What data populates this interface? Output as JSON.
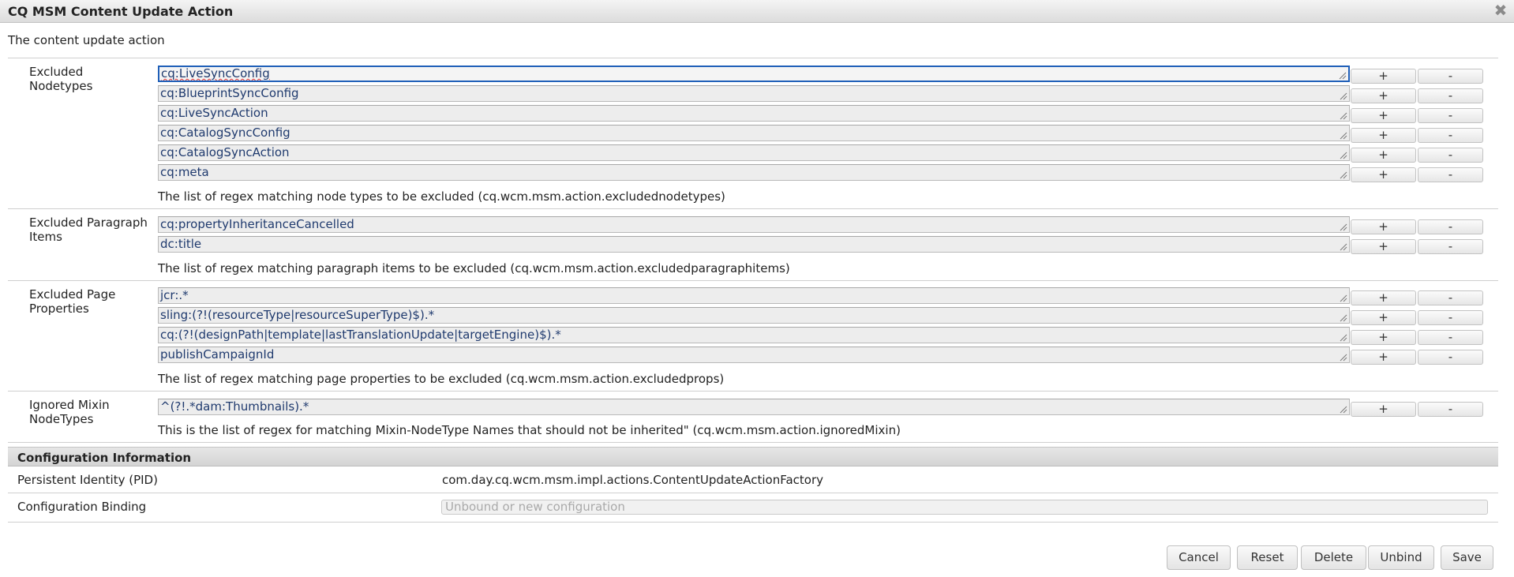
{
  "dialog": {
    "title": "CQ MSM Content Update Action",
    "close_icon": "close-icon",
    "description": "The content update action"
  },
  "properties": {
    "excluded_nodetypes": {
      "label_line1": "Excluded",
      "label_line2": "Nodetypes",
      "values": [
        "cq:LiveSyncConfig",
        "cq:BlueprintSyncConfig",
        "cq:LiveSyncAction",
        "cq:CatalogSyncConfig",
        "cq:CatalogSyncAction",
        "cq:meta"
      ],
      "description": "The list of regex matching node types to be excluded (cq.wcm.msm.action.excludednodetypes)"
    },
    "excluded_paragraph_items": {
      "label_line1": "Excluded Paragraph",
      "label_line2": "Items",
      "values": [
        "cq:propertyInheritanceCancelled",
        "dc:title"
      ],
      "description": "The list of regex matching paragraph items to be excluded (cq.wcm.msm.action.excludedparagraphitems)"
    },
    "excluded_page_properties": {
      "label_line1": "Excluded Page",
      "label_line2": "Properties",
      "values": [
        "jcr:.*",
        "sling:(?!(resourceType|resourceSuperType)$).*",
        "cq:(?!(designPath|template|lastTranslationUpdate|targetEngine)$).*",
        "publishCampaignId"
      ],
      "description": "The list of regex matching page properties to be excluded (cq.wcm.msm.action.excludedprops)"
    },
    "ignored_mixin_nodetypes": {
      "label_line1": "Ignored Mixin",
      "label_line2": "NodeTypes",
      "values": [
        "^(?!.*dam:Thumbnails).*"
      ],
      "description": "This is the list of regex for matching Mixin-NodeType Names that should not be inherited\" (cq.wcm.msm.action.ignoredMixin)"
    }
  },
  "buttons": {
    "add_label": "+",
    "remove_label": "-"
  },
  "config_info": {
    "header": "Configuration Information",
    "pid_label": "Persistent Identity (PID)",
    "pid_value": "com.day.cq.wcm.msm.impl.actions.ContentUpdateActionFactory",
    "binding_label": "Configuration Binding",
    "binding_placeholder": "Unbound or new configuration"
  },
  "footer": {
    "cancel": "Cancel",
    "reset": "Reset",
    "delete": "Delete",
    "unbind": "Unbind",
    "save": "Save"
  },
  "colors": {
    "focus_border": "#1f5fb8",
    "value_text": "#1f3a6e",
    "spellcheck": "#e03030"
  }
}
